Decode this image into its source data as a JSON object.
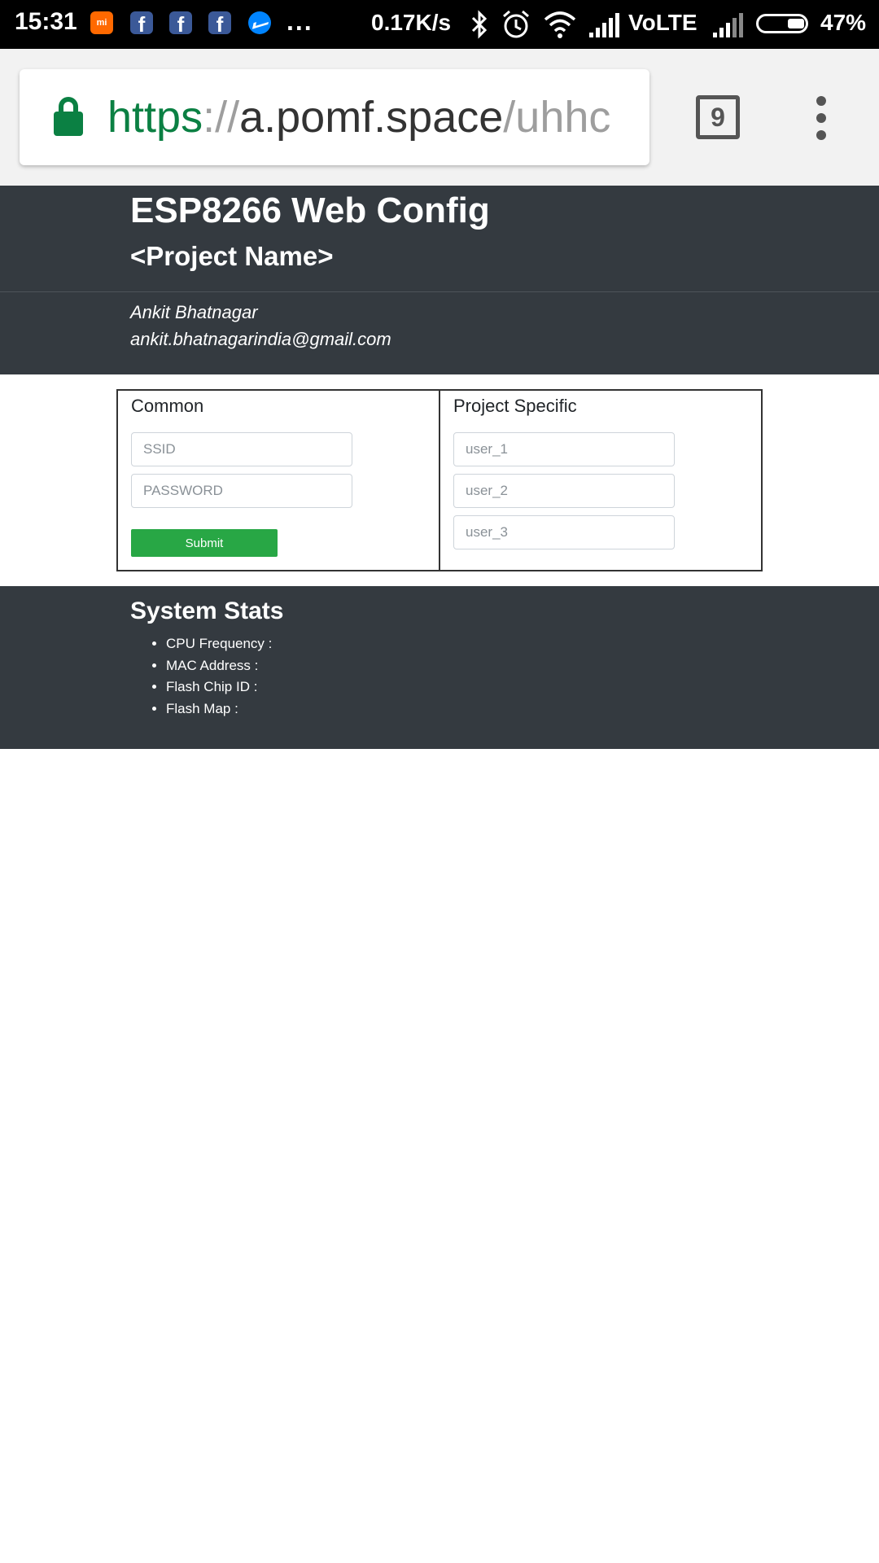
{
  "status_bar": {
    "time": "15:31",
    "notification_icons": [
      "mi-app-icon",
      "facebook-icon",
      "facebook-icon",
      "facebook-icon",
      "messenger-icon"
    ],
    "more": "...",
    "net_speed": "0.17K/s",
    "network_label": "VoLTE",
    "battery_percent": "47%",
    "battery_level": 0.47
  },
  "browser": {
    "url_scheme": "https",
    "url_separator": "://",
    "url_host": "a.pomf.space",
    "url_path": "/uhhc",
    "tab_count": "9",
    "accent_color": "#0b8043"
  },
  "page": {
    "title": "ESP8266 Web Config",
    "subtitle": "<Project Name>",
    "author": "Ankit Bhatnagar",
    "email": "ankit.bhatnagarindia@gmail.com",
    "header_bg": "#343a40",
    "common": {
      "title": "Common",
      "ssid_placeholder": "SSID",
      "password_placeholder": "PASSWORD",
      "submit_label": "Submit",
      "submit_color": "#28a745"
    },
    "project": {
      "title": "Project Specific",
      "fields": [
        "user_1",
        "user_2",
        "user_3"
      ]
    },
    "stats": {
      "title": "System Stats",
      "items": [
        "CPU Frequency :",
        "MAC Address :",
        "Flash Chip ID :",
        "Flash Map :"
      ]
    }
  }
}
